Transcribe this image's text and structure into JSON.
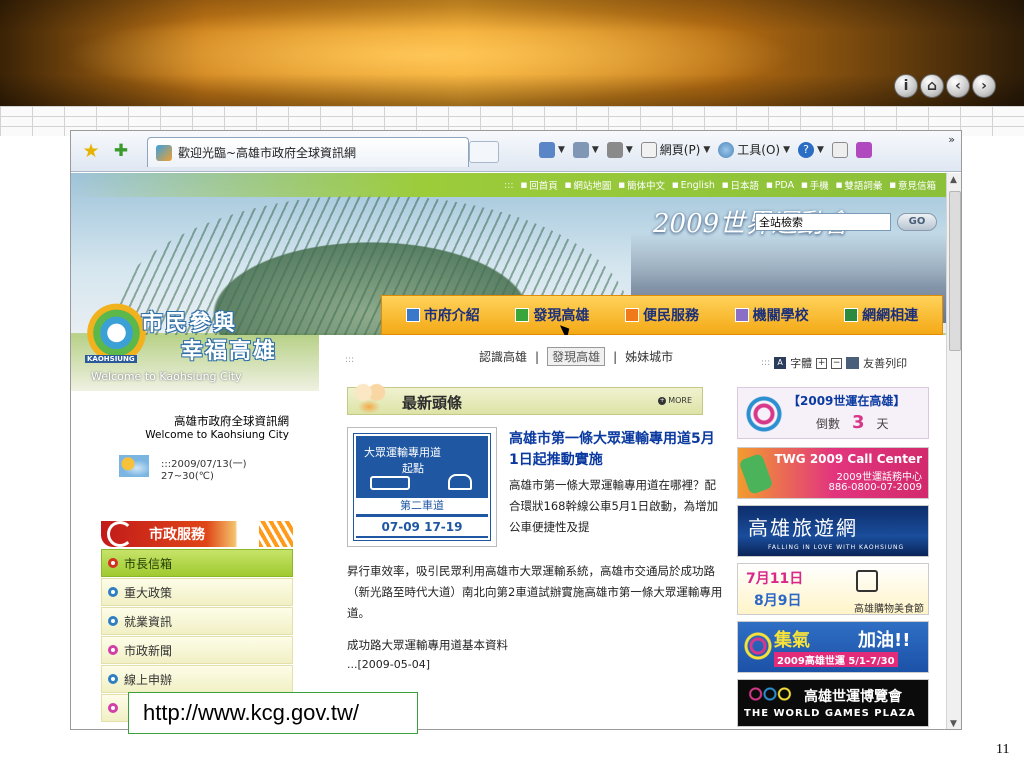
{
  "slide": {
    "nav_buttons": [
      "i",
      "⌂",
      "‹",
      "›"
    ],
    "url_label": "http://www.kcg.gov.tw/",
    "page_number": "11"
  },
  "browser": {
    "tab_title": "歡迎光臨~高雄市政府全球資訊網",
    "commands": {
      "page": "網頁(P)",
      "tools": "工具(O)"
    },
    "more": "»"
  },
  "site": {
    "top_links": [
      "回首頁",
      "網站地圖",
      "簡体中文",
      "English",
      "日本語",
      "PDA",
      "手機",
      "雙語詞彙",
      "意見信箱"
    ],
    "event_title": "2009世界運動會",
    "search_placeholder": "全站檢索",
    "search_button": "GO",
    "slogan_line1": "市民參與",
    "slogan_line2": "幸福高雄",
    "logo_caption": "KAOHSIUNG",
    "welcome_city": "Welcome to  Kaohsiung City",
    "main_menu": [
      "市府介紹",
      "發現高雄",
      "便民服務",
      "機關學校",
      "網網相連"
    ],
    "sub_nav": [
      "認識高雄",
      "發現高雄",
      "姊妹城市"
    ],
    "site_name_zh": "高雄市政府全球資訊網",
    "site_name_en": "Welcome to Kaohsiung City",
    "weather": {
      "date": ":::2009/07/13(一)",
      "temp": "27~30(℃)"
    },
    "services_title": "市政服務",
    "services": [
      "市長信箱",
      "重大政策",
      "就業資訊",
      "市政新聞",
      "線上申辦"
    ],
    "tools": {
      "font_label": "字體",
      "print_label": "友善列印"
    }
  },
  "news": {
    "section_title": "最新頭條",
    "more_label": "MORE",
    "sign": {
      "line1": "大眾運輸專用道",
      "line2": "起點",
      "lane": "第二車道",
      "hours": "07-09  17-19"
    },
    "title": "高雄市第一條大眾運輸專用道5月1日起推動實施",
    "body_side": "高雄市第一條大眾運輸專用道在哪裡？配合環狀168幹線公車5月1日啟動，為增加公車便捷性及提",
    "body_full": "昇行車效率，吸引民眾利用高雄市大眾運輸系統，高雄市交通局於成功路（新光路至時代大道）南北向第2車道試辦實施高雄市第一條大眾運輸專用道。",
    "link": "成功路大眾運輸專用道基本資料",
    "date": "...[2009-05-04]"
  },
  "sidebar": {
    "countdown": {
      "title": "【2009世運在高雄】",
      "label": "倒數",
      "days": "3",
      "unit": "天"
    },
    "banner_call": {
      "title": "TWG 2009 Call Center",
      "line2": "2009世運話務中心",
      "line3": "886-0800-07-2009"
    },
    "banner_travel": {
      "title": "高雄旅遊網",
      "sub": "FALLING IN LOVE WITH KAOHSIUNG"
    },
    "banner_food": {
      "line1": "7月11日",
      "line2": "8月9日",
      "caption": "高雄購物美食節"
    },
    "banner_boost": {
      "title_a": "集氣",
      "title_b": "加油!!",
      "sub": "2009高雄世運 5/1-7/30"
    },
    "banner_expo": {
      "title": "高雄世運博覽會",
      "sub": "THE WORLD GAMES PLAZA"
    }
  },
  "colors": {
    "accent_green": "#9ccc3a",
    "menu_orange": "#f4a916",
    "service_red": "#c21a1a",
    "link_blue": "#0a3aa0"
  }
}
